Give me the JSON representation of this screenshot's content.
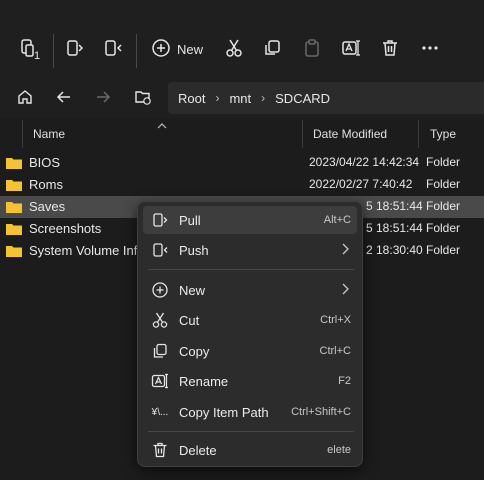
{
  "toolbar": {
    "badge": "1",
    "new_label": "New"
  },
  "address": {
    "crumbs": [
      "Root",
      "mnt",
      "SDCARD"
    ]
  },
  "columns": {
    "name": "Name",
    "date": "Date Modified",
    "type": "Type"
  },
  "rows": [
    {
      "name": "BIOS",
      "date": "2023/04/22 14:42:34",
      "type": "Folder"
    },
    {
      "name": "Roms",
      "date": "2022/02/27 7:40:42",
      "type": "Folder"
    },
    {
      "name": "Saves",
      "date": "5 18:51:44",
      "type": "Folder"
    },
    {
      "name": "Screenshots",
      "date": "5 18:51:44",
      "type": "Folder"
    },
    {
      "name": "System Volume Inf",
      "date": "2 18:30:40",
      "type": "Folder"
    }
  ],
  "menu": {
    "pull": {
      "label": "Pull",
      "shortcut": "Alt+C"
    },
    "push": {
      "label": "Push"
    },
    "new": {
      "label": "New"
    },
    "cut": {
      "label": "Cut",
      "shortcut": "Ctrl+X"
    },
    "copy": {
      "label": "Copy",
      "shortcut": "Ctrl+C"
    },
    "rename": {
      "label": "Rename",
      "shortcut": "F2"
    },
    "copy_path": {
      "label": "Copy Item Path",
      "shortcut": "Ctrl+Shift+C",
      "icon_text": "¥\\..."
    },
    "delete": {
      "label": "Delete",
      "shortcut": "elete"
    }
  },
  "colors": {
    "folder": "#f4c430",
    "selected_row": "#4a4a4a",
    "menu_bg": "#2c2c2c"
  }
}
